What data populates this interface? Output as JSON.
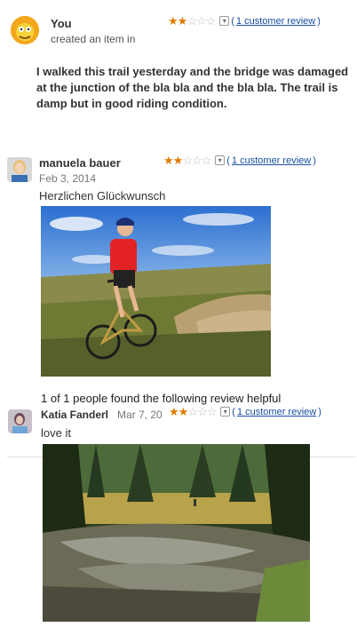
{
  "post1": {
    "author": "You",
    "action": "created an item in",
    "rating": 2,
    "rating_max": 5,
    "review_link": "1 customer review",
    "text": "I walked this trail yesterday and the bridge was damaged at the junction of the bla bla and the bla bla. The trail is damp but in good riding condition."
  },
  "post2": {
    "author": "manuela bauer",
    "date": "Feb 3, 2014",
    "rating": 2,
    "rating_max": 5,
    "review_link": "1 customer review",
    "text": "Herzlichen Glückwunsch"
  },
  "post3": {
    "helpful_text": "1 of 1 people found the following review helpful",
    "author": "Katia Fanderl",
    "date": "Mar 7, 20",
    "rating": 2,
    "rating_max": 5,
    "review_link": "1 customer review",
    "text": "love it"
  },
  "icons": {
    "dropdown": "chevron-down-icon"
  },
  "colors": {
    "link": "#1a4fa0",
    "star": "#e07b00"
  }
}
